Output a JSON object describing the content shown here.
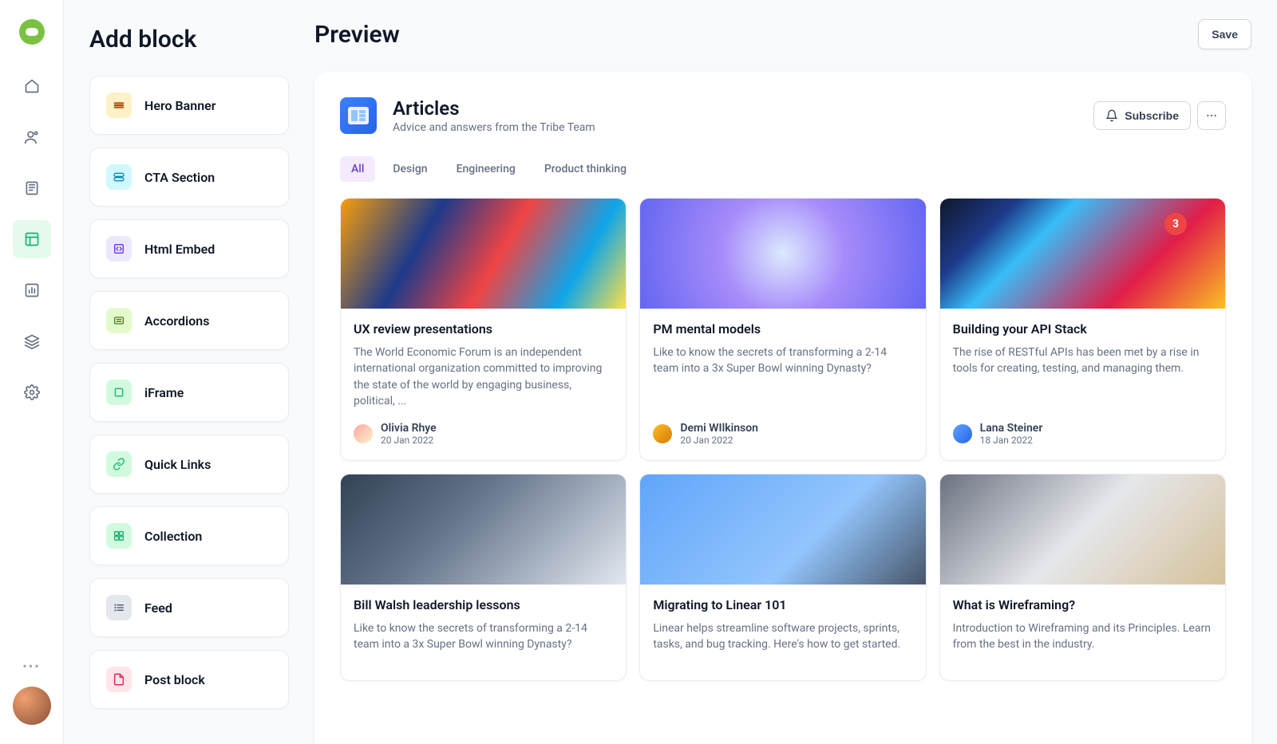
{
  "rail": {
    "items": [
      {
        "name": "home-icon"
      },
      {
        "name": "user-icon"
      },
      {
        "name": "book-icon"
      },
      {
        "name": "layout-icon"
      },
      {
        "name": "chart-icon"
      },
      {
        "name": "layers-icon"
      },
      {
        "name": "settings-icon"
      }
    ]
  },
  "blocks": {
    "title": "Add block",
    "items": [
      {
        "label": "Hero Banner",
        "color": "amber",
        "icon": "hero-banner-icon"
      },
      {
        "label": "CTA Section",
        "color": "cyan",
        "icon": "cta-section-icon"
      },
      {
        "label": "Html Embed",
        "color": "violet",
        "icon": "html-embed-icon"
      },
      {
        "label": "Accordions",
        "color": "lime",
        "icon": "accordions-icon"
      },
      {
        "label": "iFrame",
        "color": "mint",
        "icon": "iframe-icon"
      },
      {
        "label": "Quick Links",
        "color": "mint",
        "icon": "quick-links-icon"
      },
      {
        "label": "Collection",
        "color": "mint",
        "icon": "collection-icon"
      },
      {
        "label": "Feed",
        "color": "slate",
        "icon": "feed-icon"
      },
      {
        "label": "Post block",
        "color": "rose",
        "icon": "post-block-icon"
      }
    ]
  },
  "preview": {
    "title": "Preview",
    "save_label": "Save",
    "header": {
      "title": "Articles",
      "subtitle": "Advice and answers from the Tribe Team",
      "subscribe_label": "Subscribe"
    },
    "filters": [
      {
        "label": "All",
        "active": true
      },
      {
        "label": "Design",
        "active": false
      },
      {
        "label": "Engineering",
        "active": false
      },
      {
        "label": "Product thinking",
        "active": false
      }
    ],
    "articles": [
      {
        "title": "UX review presentations",
        "desc": "The World Economic Forum is an independent international organization committed to improving the state of the world by engaging business, political, ...",
        "author": "Olivia Rhye",
        "date": "20 Jan 2022",
        "img": "img1",
        "avatar": "av1"
      },
      {
        "title": "PM mental models",
        "desc": "Like to know the secrets of transforming a 2-14 team into a 3x Super Bowl winning Dynasty?",
        "author": "Demi WIlkinson",
        "date": "20 Jan 2022",
        "img": "img2",
        "avatar": "av2"
      },
      {
        "title": "Building your API Stack",
        "desc": "The rise of RESTful APIs has been met by a rise in tools for creating, testing, and managing them.",
        "author": "Lana Steiner",
        "date": "18 Jan 2022",
        "img": "img3",
        "avatar": "av3"
      },
      {
        "title": "Bill Walsh leadership lessons",
        "desc": "Like to know the secrets of transforming a 2-14 team into a 3x Super Bowl winning Dynasty?",
        "author": "",
        "date": "",
        "img": "img4",
        "avatar": ""
      },
      {
        "title": "Migrating to Linear 101",
        "desc": "Linear helps streamline software projects, sprints, tasks, and bug tracking. Here's how to get started.",
        "author": "",
        "date": "",
        "img": "img5",
        "avatar": ""
      },
      {
        "title": "What is Wireframing?",
        "desc": "Introduction to Wireframing and its Principles. Learn from the best in the industry.",
        "author": "",
        "date": "",
        "img": "img6",
        "avatar": ""
      }
    ]
  }
}
